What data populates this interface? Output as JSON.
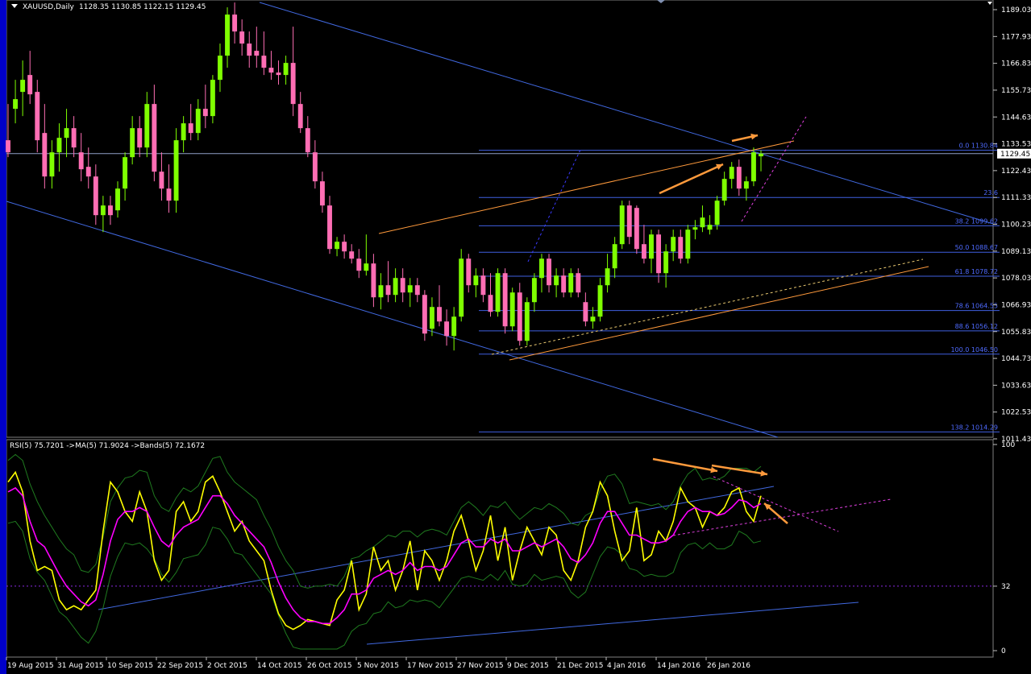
{
  "header": {
    "symbol": "XAUUSD,Daily",
    "ohlc": "1128.35 1130.85 1122.15 1129.45"
  },
  "price_axis": {
    "ticks": [
      "1189.03",
      "1177.93",
      "1166.83",
      "1155.73",
      "1144.63",
      "1133.53",
      "1122.43",
      "1111.33",
      "1100.23",
      "1089.13",
      "1078.03",
      "1066.93",
      "1055.83",
      "1044.73",
      "1033.63",
      "1022.53",
      "1011.43"
    ],
    "current_price": "1129.45"
  },
  "fibonacci": {
    "levels": [
      {
        "label": "0.0 1130.84",
        "price": 1130.84
      },
      {
        "label": "23.6",
        "price": 1111.33
      },
      {
        "label": "38.2 1099.62",
        "price": 1099.62
      },
      {
        "label": "50.0 1088.67",
        "price": 1088.67
      },
      {
        "label": "61.8 1078.72",
        "price": 1078.72
      },
      {
        "label": "78.6 1064.55",
        "price": 1064.55
      },
      {
        "label": "88.6 1056.12",
        "price": 1056.12
      },
      {
        "label": "100.0 1046.50",
        "price": 1046.5
      },
      {
        "label": "138.2 1014.29",
        "price": 1014.29
      }
    ]
  },
  "indicator": {
    "header": "RSI(5) 75.7201  ->MA(5) 71.9024  ->Bands(5) 72.1672",
    "ticks": [
      "100",
      "32",
      "0"
    ],
    "level": 32
  },
  "time_axis": {
    "labels": [
      "19 Aug 2015",
      "31 Aug 2015",
      "10 Sep 2015",
      "22 Sep 2015",
      "2 Oct 2015",
      "14 Oct 2015",
      "26 Oct 2015",
      "5 Nov 2015",
      "17 Nov 2015",
      "27 Nov 2015",
      "9 Dec 2015",
      "21 Dec 2015",
      "4 Jan 2016",
      "14 Jan 2016",
      "26 Jan 2016"
    ]
  },
  "colors": {
    "bull": "#7fff00",
    "bear": "#ff6eb4",
    "rsi": "#ffff00",
    "ma": "#ff00ff",
    "bands": "#1f7a1f",
    "channel": "#4169e1",
    "fib": "#3f5fe0",
    "orange": "#ff9a3c",
    "axis": "#c0c0c0"
  },
  "chart_data": {
    "type": "candlestick",
    "y_range": [
      1011.43,
      1193.0
    ],
    "candles": [
      {
        "o": 1135.0,
        "h": 1150.0,
        "l": 1128.0,
        "c": 1130.0
      },
      {
        "o": 1148.0,
        "h": 1160.0,
        "l": 1142.0,
        "c": 1152.0
      },
      {
        "o": 1155.0,
        "h": 1168.0,
        "l": 1145.0,
        "c": 1160.0
      },
      {
        "o": 1162.0,
        "h": 1172.0,
        "l": 1150.0,
        "c": 1154.0
      },
      {
        "o": 1155.0,
        "h": 1160.0,
        "l": 1130.0,
        "c": 1135.0
      },
      {
        "o": 1138.0,
        "h": 1150.0,
        "l": 1115.0,
        "c": 1120.0
      },
      {
        "o": 1120.0,
        "h": 1135.0,
        "l": 1115.0,
        "c": 1130.0
      },
      {
        "o": 1130.0,
        "h": 1142.0,
        "l": 1122.0,
        "c": 1136.0
      },
      {
        "o": 1136.0,
        "h": 1148.0,
        "l": 1128.0,
        "c": 1140.0
      },
      {
        "o": 1140.0,
        "h": 1145.0,
        "l": 1128.0,
        "c": 1132.0
      },
      {
        "o": 1130.0,
        "h": 1138.0,
        "l": 1118.0,
        "c": 1123.0
      },
      {
        "o": 1124.0,
        "h": 1132.0,
        "l": 1115.0,
        "c": 1120.0
      },
      {
        "o": 1120.0,
        "h": 1125.0,
        "l": 1100.0,
        "c": 1104.0
      },
      {
        "o": 1104.0,
        "h": 1112.0,
        "l": 1097.0,
        "c": 1108.0
      },
      {
        "o": 1108.0,
        "h": 1112.0,
        "l": 1100.0,
        "c": 1104.0
      },
      {
        "o": 1106.0,
        "h": 1118.0,
        "l": 1103.0,
        "c": 1115.0
      },
      {
        "o": 1115.0,
        "h": 1130.0,
        "l": 1110.0,
        "c": 1128.0
      },
      {
        "o": 1128.0,
        "h": 1145.0,
        "l": 1125.0,
        "c": 1140.0
      },
      {
        "o": 1140.0,
        "h": 1145.0,
        "l": 1128.0,
        "c": 1132.0
      },
      {
        "o": 1132.0,
        "h": 1155.0,
        "l": 1128.0,
        "c": 1150.0
      },
      {
        "o": 1150.0,
        "h": 1158.0,
        "l": 1118.0,
        "c": 1122.0
      },
      {
        "o": 1122.0,
        "h": 1130.0,
        "l": 1110.0,
        "c": 1115.0
      },
      {
        "o": 1115.0,
        "h": 1125.0,
        "l": 1105.0,
        "c": 1110.0
      },
      {
        "o": 1110.0,
        "h": 1140.0,
        "l": 1105.0,
        "c": 1135.0
      },
      {
        "o": 1135.0,
        "h": 1145.0,
        "l": 1130.0,
        "c": 1142.0
      },
      {
        "o": 1142.0,
        "h": 1150.0,
        "l": 1135.0,
        "c": 1138.0
      },
      {
        "o": 1138.0,
        "h": 1152.0,
        "l": 1135.0,
        "c": 1148.0
      },
      {
        "o": 1148.0,
        "h": 1158.0,
        "l": 1140.0,
        "c": 1145.0
      },
      {
        "o": 1145.0,
        "h": 1162.0,
        "l": 1142.0,
        "c": 1160.0
      },
      {
        "o": 1160.0,
        "h": 1175.0,
        "l": 1155.0,
        "c": 1170.0
      },
      {
        "o": 1170.0,
        "h": 1190.0,
        "l": 1165.0,
        "c": 1187.0
      },
      {
        "o": 1187.0,
        "h": 1192.0,
        "l": 1175.0,
        "c": 1180.0
      },
      {
        "o": 1180.0,
        "h": 1185.0,
        "l": 1170.0,
        "c": 1175.0
      },
      {
        "o": 1175.0,
        "h": 1180.0,
        "l": 1165.0,
        "c": 1170.0
      },
      {
        "o": 1172.0,
        "h": 1182.0,
        "l": 1165.0,
        "c": 1170.0
      },
      {
        "o": 1170.0,
        "h": 1180.0,
        "l": 1162.0,
        "c": 1165.0
      },
      {
        "o": 1165.0,
        "h": 1172.0,
        "l": 1160.0,
        "c": 1163.0
      },
      {
        "o": 1163.0,
        "h": 1168.0,
        "l": 1158.0,
        "c": 1162.0
      },
      {
        "o": 1162.0,
        "h": 1170.0,
        "l": 1158.0,
        "c": 1167.0
      },
      {
        "o": 1167.0,
        "h": 1182.0,
        "l": 1145.0,
        "c": 1150.0
      },
      {
        "o": 1150.0,
        "h": 1155.0,
        "l": 1138.0,
        "c": 1140.0
      },
      {
        "o": 1140.0,
        "h": 1145.0,
        "l": 1128.0,
        "c": 1130.0
      },
      {
        "o": 1130.0,
        "h": 1135.0,
        "l": 1115.0,
        "c": 1118.0
      },
      {
        "o": 1118.0,
        "h": 1122.0,
        "l": 1105.0,
        "c": 1108.0
      },
      {
        "o": 1108.0,
        "h": 1112.0,
        "l": 1088.0,
        "c": 1090.0
      },
      {
        "o": 1090.0,
        "h": 1095.0,
        "l": 1087.0,
        "c": 1093.0
      },
      {
        "o": 1093.0,
        "h": 1096.0,
        "l": 1086.0,
        "c": 1089.0
      },
      {
        "o": 1089.0,
        "h": 1092.0,
        "l": 1084.0,
        "c": 1086.0
      },
      {
        "o": 1086.0,
        "h": 1090.0,
        "l": 1078.0,
        "c": 1081.0
      },
      {
        "o": 1081.0,
        "h": 1096.0,
        "l": 1079.0,
        "c": 1084.0
      },
      {
        "o": 1084.0,
        "h": 1088.0,
        "l": 1066.0,
        "c": 1070.0
      },
      {
        "o": 1070.0,
        "h": 1080.0,
        "l": 1065.0,
        "c": 1075.0
      },
      {
        "o": 1075.0,
        "h": 1085.0,
        "l": 1068.0,
        "c": 1071.0
      },
      {
        "o": 1071.0,
        "h": 1082.0,
        "l": 1068.0,
        "c": 1078.0
      },
      {
        "o": 1078.0,
        "h": 1082.0,
        "l": 1068.0,
        "c": 1072.0
      },
      {
        "o": 1072.0,
        "h": 1078.0,
        "l": 1066.0,
        "c": 1075.0
      },
      {
        "o": 1075.0,
        "h": 1078.0,
        "l": 1068.0,
        "c": 1071.0
      },
      {
        "o": 1071.0,
        "h": 1073.0,
        "l": 1052.0,
        "c": 1055.0
      },
      {
        "o": 1057.0,
        "h": 1070.0,
        "l": 1054.0,
        "c": 1066.0
      },
      {
        "o": 1066.0,
        "h": 1075.0,
        "l": 1058.0,
        "c": 1060.0
      },
      {
        "o": 1060.0,
        "h": 1065.0,
        "l": 1050.0,
        "c": 1054.0
      },
      {
        "o": 1054.0,
        "h": 1066.0,
        "l": 1048.0,
        "c": 1062.0
      },
      {
        "o": 1062.0,
        "h": 1090.0,
        "l": 1060.0,
        "c": 1086.0
      },
      {
        "o": 1086.0,
        "h": 1088.0,
        "l": 1072.0,
        "c": 1075.0
      },
      {
        "o": 1075.0,
        "h": 1082.0,
        "l": 1070.0,
        "c": 1079.0
      },
      {
        "o": 1079.0,
        "h": 1082.0,
        "l": 1068.0,
        "c": 1071.0
      },
      {
        "o": 1071.0,
        "h": 1080.0,
        "l": 1062.0,
        "c": 1064.0
      },
      {
        "o": 1064.0,
        "h": 1082.0,
        "l": 1062.0,
        "c": 1080.0
      },
      {
        "o": 1080.0,
        "h": 1082.0,
        "l": 1055.0,
        "c": 1058.0
      },
      {
        "o": 1058.0,
        "h": 1074.0,
        "l": 1056.0,
        "c": 1072.0
      },
      {
        "o": 1072.0,
        "h": 1076.0,
        "l": 1050.0,
        "c": 1052.0
      },
      {
        "o": 1052.0,
        "h": 1070.0,
        "l": 1050.0,
        "c": 1068.0
      },
      {
        "o": 1068.0,
        "h": 1080.0,
        "l": 1064.0,
        "c": 1078.0
      },
      {
        "o": 1078.0,
        "h": 1088.0,
        "l": 1072.0,
        "c": 1086.0
      },
      {
        "o": 1086.0,
        "h": 1088.0,
        "l": 1072.0,
        "c": 1075.0
      },
      {
        "o": 1075.0,
        "h": 1082.0,
        "l": 1070.0,
        "c": 1079.0
      },
      {
        "o": 1079.0,
        "h": 1082.0,
        "l": 1070.0,
        "c": 1072.0
      },
      {
        "o": 1072.0,
        "h": 1082.0,
        "l": 1070.0,
        "c": 1080.0
      },
      {
        "o": 1080.0,
        "h": 1082.0,
        "l": 1070.0,
        "c": 1072.0
      },
      {
        "o": 1068.0,
        "h": 1072.0,
        "l": 1058.0,
        "c": 1060.0
      },
      {
        "o": 1060.0,
        "h": 1066.0,
        "l": 1057.0,
        "c": 1062.0
      },
      {
        "o": 1062.0,
        "h": 1078.0,
        "l": 1060.0,
        "c": 1075.0
      },
      {
        "o": 1075.0,
        "h": 1088.0,
        "l": 1072.0,
        "c": 1082.0
      },
      {
        "o": 1082.0,
        "h": 1095.0,
        "l": 1078.0,
        "c": 1092.0
      },
      {
        "o": 1092.0,
        "h": 1110.0,
        "l": 1090.0,
        "c": 1108.0
      },
      {
        "o": 1108.0,
        "h": 1110.0,
        "l": 1092.0,
        "c": 1095.0
      },
      {
        "o": 1107.0,
        "h": 1108.0,
        "l": 1088.0,
        "c": 1090.0
      },
      {
        "o": 1092.0,
        "h": 1100.0,
        "l": 1084.0,
        "c": 1086.0
      },
      {
        "o": 1086.0,
        "h": 1098.0,
        "l": 1080.0,
        "c": 1096.0
      },
      {
        "o": 1096.0,
        "h": 1098.0,
        "l": 1076.0,
        "c": 1080.0
      },
      {
        "o": 1080.0,
        "h": 1092.0,
        "l": 1074.0,
        "c": 1089.0
      },
      {
        "o": 1089.0,
        "h": 1098.0,
        "l": 1085.0,
        "c": 1095.0
      },
      {
        "o": 1095.0,
        "h": 1098.0,
        "l": 1084.0,
        "c": 1086.0
      },
      {
        "o": 1086.0,
        "h": 1100.0,
        "l": 1084.0,
        "c": 1098.0
      },
      {
        "o": 1098.0,
        "h": 1102.0,
        "l": 1094.0,
        "c": 1099.0
      },
      {
        "o": 1099.0,
        "h": 1108.0,
        "l": 1097.0,
        "c": 1103.0
      },
      {
        "o": 1098.0,
        "h": 1104.0,
        "l": 1096.0,
        "c": 1100.0
      },
      {
        "o": 1100.0,
        "h": 1112.0,
        "l": 1098.0,
        "c": 1110.0
      },
      {
        "o": 1110.0,
        "h": 1122.0,
        "l": 1108.0,
        "c": 1119.0
      },
      {
        "o": 1119.0,
        "h": 1126.0,
        "l": 1115.0,
        "c": 1124.0
      },
      {
        "o": 1124.0,
        "h": 1127.0,
        "l": 1112.0,
        "c": 1115.0
      },
      {
        "o": 1115.0,
        "h": 1120.0,
        "l": 1110.0,
        "c": 1118.0
      },
      {
        "o": 1118.0,
        "h": 1132.0,
        "l": 1116.0,
        "c": 1130.0
      },
      {
        "o": 1128.35,
        "h": 1130.85,
        "l": 1122.15,
        "c": 1129.45
      }
    ],
    "rsi": [
      85,
      90,
      80,
      55,
      40,
      42,
      40,
      25,
      20,
      22,
      20,
      25,
      30,
      60,
      85,
      80,
      70,
      65,
      80,
      70,
      45,
      35,
      40,
      70,
      75,
      65,
      70,
      85,
      88,
      80,
      70,
      60,
      65,
      55,
      50,
      45,
      30,
      18,
      12,
      10,
      12,
      15,
      14,
      13,
      12,
      25,
      30,
      45,
      20,
      28,
      52,
      40,
      45,
      30,
      40,
      55,
      30,
      50,
      45,
      35,
      45,
      60,
      68,
      55,
      40,
      50,
      68,
      45,
      62,
      35,
      50,
      62,
      55,
      48,
      62,
      58,
      40,
      35,
      45,
      62,
      70,
      85,
      78,
      60,
      45,
      50,
      72,
      45,
      48,
      60,
      55,
      65,
      82,
      75,
      72,
      62,
      70,
      68,
      72,
      80,
      82,
      70,
      65,
      78
    ],
    "rsi_ma": [
      80,
      82,
      78,
      65,
      55,
      52,
      45,
      38,
      32,
      28,
      24,
      22,
      25,
      38,
      55,
      66,
      70,
      70,
      72,
      70,
      62,
      55,
      52,
      58,
      62,
      64,
      66,
      72,
      78,
      78,
      74,
      68,
      64,
      60,
      56,
      52,
      44,
      34,
      26,
      20,
      16,
      14,
      14,
      13,
      13,
      16,
      20,
      28,
      28,
      30,
      36,
      38,
      40,
      38,
      40,
      44,
      40,
      42,
      42,
      40,
      42,
      48,
      54,
      56,
      52,
      52,
      56,
      54,
      56,
      50,
      50,
      52,
      54,
      52,
      54,
      56,
      52,
      46,
      44,
      48,
      54,
      64,
      70,
      70,
      64,
      58,
      58,
      56,
      54,
      54,
      55,
      58,
      65,
      70,
      72,
      70,
      70,
      68,
      69,
      72,
      76,
      75,
      72,
      74
    ],
    "annotations": [
      "orange arrows",
      "fibonacci retracement",
      "trend channels"
    ]
  }
}
